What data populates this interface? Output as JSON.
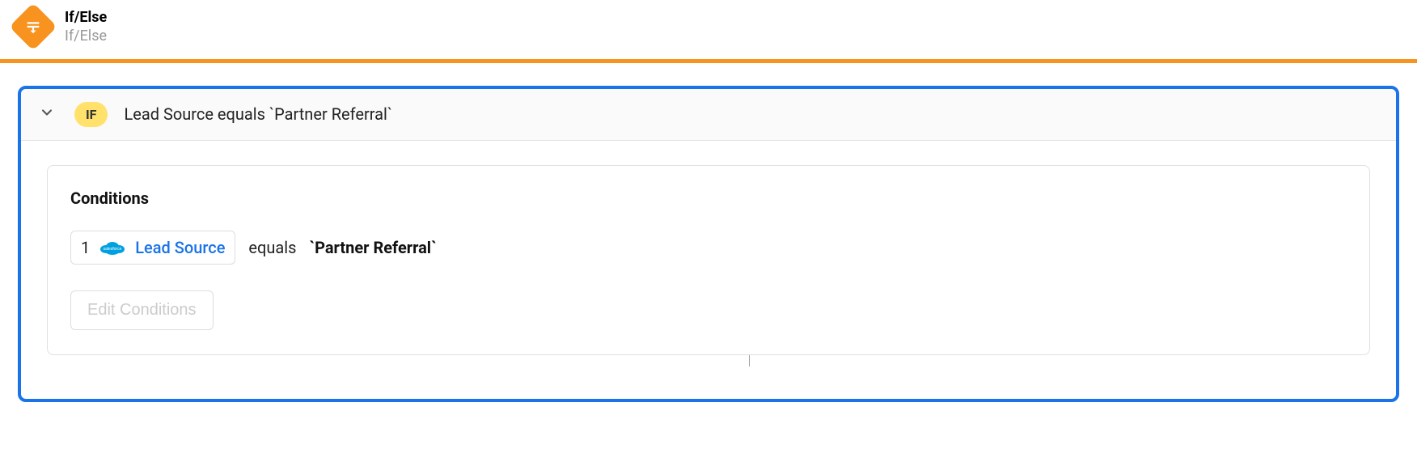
{
  "header": {
    "title": "If/Else",
    "subtitle": "If/Else"
  },
  "panel": {
    "badge": "IF",
    "summary": "Lead Source equals `Partner Referral`"
  },
  "conditions": {
    "title": "Conditions",
    "rows": [
      {
        "index": "1",
        "field": "Lead Source",
        "operator": "equals",
        "value": "`Partner Referral`"
      }
    ],
    "editButton": "Edit Conditions"
  }
}
